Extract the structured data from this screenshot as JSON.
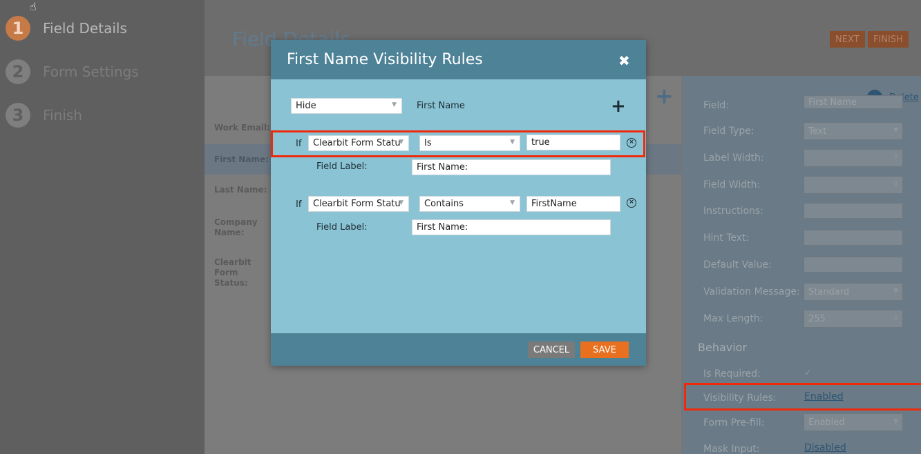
{
  "wizard": {
    "steps": [
      {
        "num": "1",
        "label": "Field Details"
      },
      {
        "num": "2",
        "label": "Form Settings"
      },
      {
        "num": "3",
        "label": "Finish"
      }
    ]
  },
  "header": {
    "title": "Field Details",
    "next_label": "NEXT",
    "finish_label": "FINISH"
  },
  "form_fields": [
    "Work Email:",
    "First Name:",
    "Last Name:",
    "Company Name:",
    "Clearbit Form Status:"
  ],
  "properties": {
    "delete_label": "Delete",
    "field_label": "Field:",
    "field_value": "First Name",
    "field_type_label": "Field Type:",
    "field_type_value": "Text",
    "label_width_label": "Label Width:",
    "field_width_label": "Field Width:",
    "instructions_label": "Instructions:",
    "hint_text_label": "Hint Text:",
    "default_value_label": "Default Value:",
    "validation_label": "Validation Message:",
    "validation_value": "Standard",
    "max_length_label": "Max Length:",
    "max_length_value": "255",
    "behavior_title": "Behavior",
    "is_required_label": "Is Required:",
    "visibility_label": "Visibility Rules:",
    "visibility_value": "Enabled",
    "prefill_label": "Form Pre-fill:",
    "prefill_value": "Enabled",
    "mask_label": "Mask Input:",
    "mask_value": "Disabled"
  },
  "modal": {
    "title": "First Name Visibility Rules",
    "action_value": "Hide",
    "target_field": "First Name",
    "rules": [
      {
        "if": "If",
        "field": "Clearbit Form Statu",
        "operator": "Is",
        "value": "true",
        "label_caption": "Field Label:",
        "label_value": "First Name:"
      },
      {
        "if": "If",
        "field": "Clearbit Form Statu",
        "operator": "Contains",
        "value": "FirstName",
        "label_caption": "Field Label:",
        "label_value": "First Name:"
      }
    ],
    "cancel_label": "CANCEL",
    "save_label": "SAVE"
  },
  "colors": {
    "modal_header": "#4e8397",
    "modal_body": "#8ac3d4",
    "save_button": "#e8701f",
    "cancel_button": "#7a7a7a",
    "highlight": "#f0290b"
  },
  "icons": [
    "cursor-hand-icon",
    "close-icon",
    "add-rule-icon",
    "remove-rule-icon",
    "delete-icon",
    "add-field-icon",
    "checkmark-icon",
    "caret-down-icon"
  ]
}
